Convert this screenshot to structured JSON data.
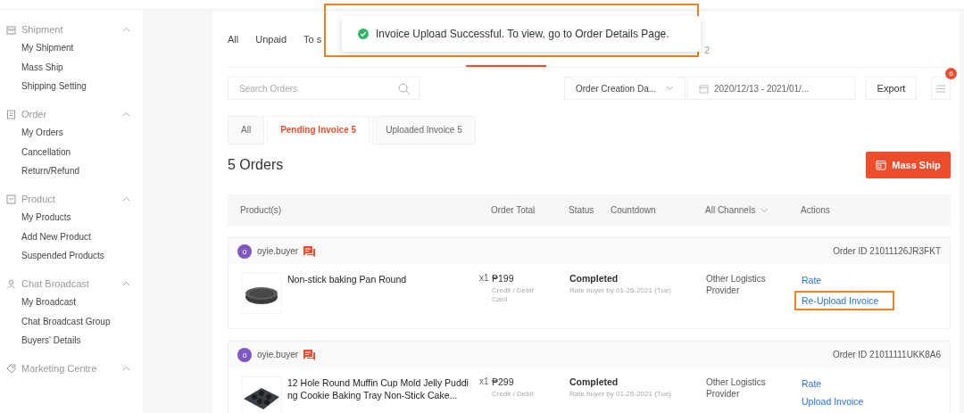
{
  "sidebar": {
    "sections": [
      {
        "title": "Shipment",
        "expanded": true,
        "items": [
          "My Shipment",
          "Mass Ship",
          "Shipping Setting"
        ]
      },
      {
        "title": "Order",
        "expanded": true,
        "items": [
          "My Orders",
          "Cancellation",
          "Return/Refund"
        ]
      },
      {
        "title": "Product",
        "expanded": true,
        "items": [
          "My Products",
          "Add New Product",
          "Suspended Products"
        ]
      },
      {
        "title": "Chat Broadcast",
        "expanded": true,
        "items": [
          "My Broadcast",
          "Chat Broadcast Group",
          "Buyers' Details"
        ]
      },
      {
        "title": "Marketing Centre",
        "expanded": true
      }
    ]
  },
  "status_tabs": [
    {
      "label": "All",
      "selected": false
    },
    {
      "label": "Unpaid",
      "selected": false
    },
    {
      "label": "To s",
      "selected": false
    },
    {
      "label": "2",
      "selected": false
    }
  ],
  "toast": {
    "message": "Invoice Upload Successful. To view, go to Order Details Page.",
    "highlighted": true
  },
  "filters": {
    "search_placeholder": "Search Orders",
    "date_type": "Order Creation Da...",
    "date_range": "2020/12/13 - 2021/01/...",
    "export": "Export",
    "badge": "6"
  },
  "invoice_tabs": [
    {
      "label": "All",
      "selected": false
    },
    {
      "label": "Pending Invoice 5",
      "selected": true
    },
    {
      "label": "Uploaded Invoice 5",
      "selected": false
    }
  ],
  "orders_count": "5 Orders",
  "mass_ship": "Mass Ship",
  "columns": [
    "Product(s)",
    "Order Total",
    "Status",
    "Countdown",
    "All Channels",
    "Actions"
  ],
  "orders": [
    {
      "avatar": "o",
      "buyer": "oyie.buyer",
      "order_id": "Order ID 21011126JR3FKT",
      "product": "Non-stick baking Pan Round",
      "qty": "x1",
      "total": "₱199",
      "payment": "Credit / Debit Card",
      "status": "Completed",
      "countdown": "Rate buyer by 01-26-2021 (Tue)",
      "channel": "Other Logistics Provider",
      "actions": [
        {
          "label": "Rate",
          "highlighted": false
        },
        {
          "label": "Re-Upload Invoice",
          "highlighted": true
        }
      ]
    },
    {
      "avatar": "o",
      "buyer": "oyie.buyer",
      "order_id": "Order ID 21011111UKK8A6",
      "product": "12 Hole Round Muffin Cup Mold Jelly Pudding Cookie Baking Tray Non-Stick Cake...",
      "qty": "x1",
      "total": "₱299",
      "payment": "Credit / Debit",
      "status": "Completed",
      "countdown": "Rate buyer by 01-26-2021 (Tue)",
      "channel": "Other Logistics Provider",
      "actions": [
        {
          "label": "Rate",
          "highlighted": false
        },
        {
          "label": "Upload Invoice",
          "highlighted": false
        }
      ]
    }
  ]
}
